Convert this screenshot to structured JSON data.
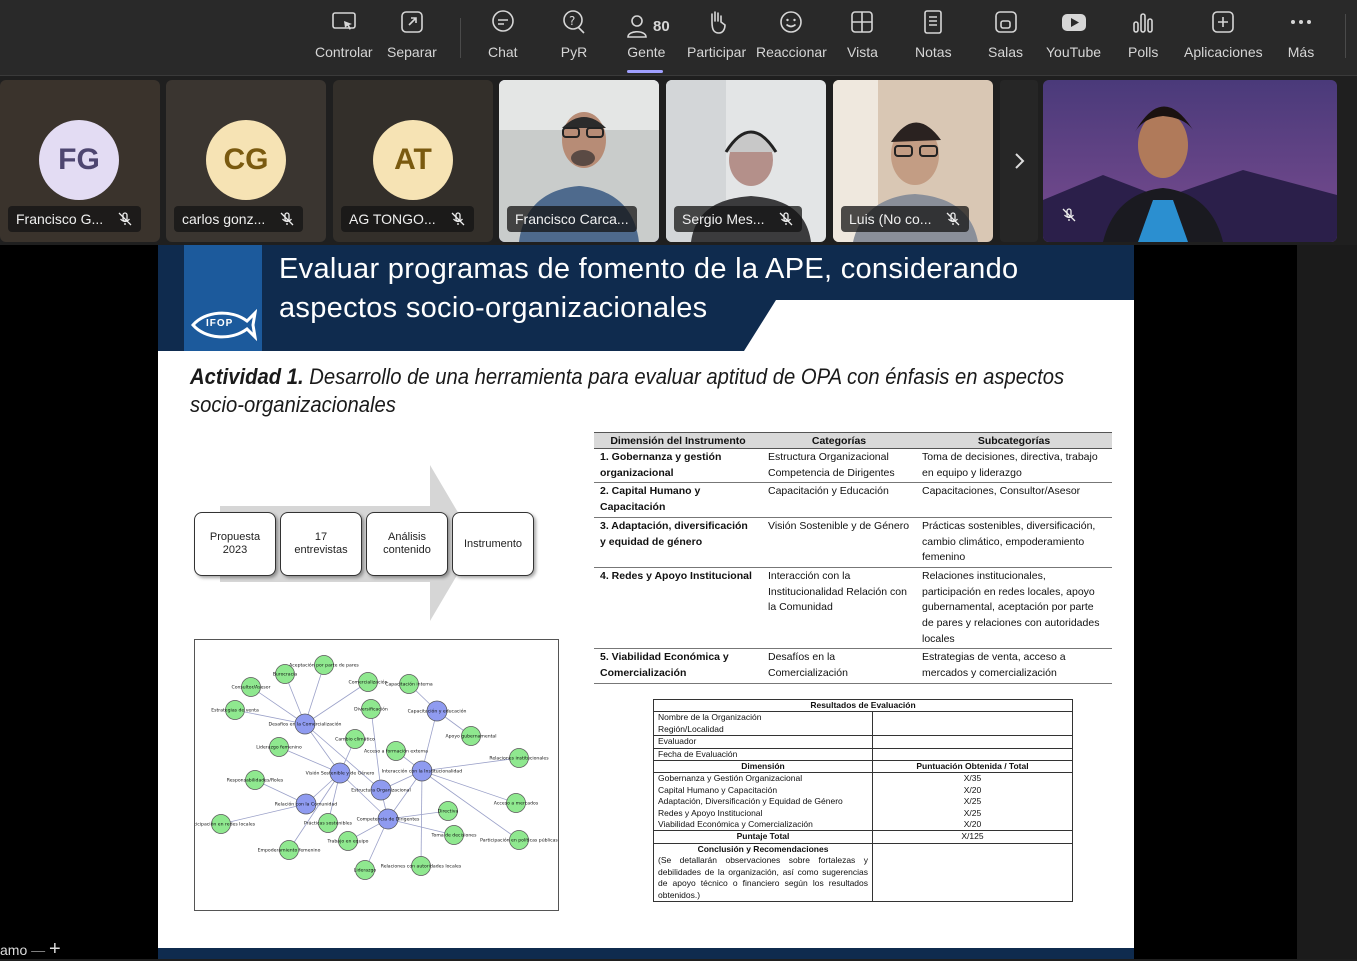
{
  "toolbar": {
    "buttons": [
      {
        "label": "Controlar",
        "icon": "share-control-icon"
      },
      {
        "label": "Separar",
        "icon": "pop-out-icon"
      },
      {
        "label": "Chat",
        "icon": "chat-icon"
      },
      {
        "label": "PyR",
        "icon": "qa-icon"
      },
      {
        "label": "Gente",
        "icon": "people-icon",
        "count": "80"
      },
      {
        "label": "Participar",
        "icon": "raise-hand-icon"
      },
      {
        "label": "Reaccionar",
        "icon": "smiley-icon"
      },
      {
        "label": "Vista",
        "icon": "grid-view-icon"
      },
      {
        "label": "Notas",
        "icon": "notes-icon"
      },
      {
        "label": "Salas",
        "icon": "rooms-icon"
      },
      {
        "label": "YouTube",
        "icon": "youtube-icon"
      },
      {
        "label": "Polls",
        "icon": "polls-icon"
      },
      {
        "label": "Aplicaciones",
        "icon": "apps-icon"
      },
      {
        "label": "Más",
        "icon": "more-icon"
      }
    ]
  },
  "participants": [
    {
      "initials": "FG",
      "name": "Francisco G..."
    },
    {
      "initials": "CG",
      "name": "carlos gonz..."
    },
    {
      "initials": "AT",
      "name": "AG TONGO..."
    },
    {
      "name": "Francisco Carca..."
    },
    {
      "name": "Sergio Mes..."
    },
    {
      "name": "Luis (No co..."
    }
  ],
  "colors": {
    "accent": "#a0a0ff",
    "slide_navy": "#0f2b4e",
    "slide_blue": "#1c5a9c"
  },
  "slide": {
    "logo_text": "IFOP",
    "title_line1": "Evaluar programas de fomento de la APE, considerando",
    "title_line2": "aspectos socio-organizacionales",
    "activity_bold": "Actividad 1.",
    "activity_text": " Desarrollo de una herramienta para evaluar aptitud de OPA con énfasis en aspectos socio-organizacionales",
    "process": [
      {
        "l1": "Propuesta",
        "l2": "2023"
      },
      {
        "l1": "17",
        "l2": "entrevistas"
      },
      {
        "l1": "Análisis",
        "l2": "contenido"
      },
      {
        "l1": "Instrumento",
        "l2": ""
      }
    ],
    "dim_table": {
      "headers": [
        "Dimensión del Instrumento",
        "Categorías",
        "Subcategorías"
      ],
      "rows": [
        {
          "dim": "1. Gobernanza y gestión organizacional",
          "cat": "Estructura Organizacional Competencia de Dirigentes",
          "sub": "Toma de decisiones, directiva, trabajo en equipo y liderazgo"
        },
        {
          "dim": "2. Capital Humano y Capacitación",
          "cat": "Capacitación y Educación",
          "sub": "Capacitaciones, Consultor/Asesor"
        },
        {
          "dim": "3. Adaptación, diversificación y equidad de género",
          "cat": "Visión Sostenible y de Género",
          "sub": "Prácticas sostenibles, diversificación, cambio climático, empoderamiento femenino"
        },
        {
          "dim": "4. Redes y Apoyo Institucional",
          "cat": "Interacción con la Institucionalidad Relación con la Comunidad",
          "sub": "Relaciones institucionales, participación en redes locales, apoyo gubernamental, aceptación por parte de pares y relaciones con autoridades locales"
        },
        {
          "dim": "5. Viabilidad Económica y Comercialización",
          "cat": "Desafíos en la Comercialización",
          "sub": "Estrategias de venta, acceso a mercados y comercialización"
        }
      ]
    },
    "eval": {
      "title": "Resultados de Evaluación",
      "fields": [
        "Nombre de la Organización",
        "Región/Localidad",
        "Evaluador",
        "Fecha de Evaluación"
      ],
      "col_dim": "Dimensión",
      "col_score": "Puntuación Obtenida / Total",
      "scores": [
        {
          "dim": "Gobernanza y Gestión Organizacional",
          "score": "X/35"
        },
        {
          "dim": "Capital Humano y Capacitación",
          "score": "X/20"
        },
        {
          "dim": "Adaptación, Diversificación y Equidad de Género",
          "score": "X/25"
        },
        {
          "dim": "Redes y Apoyo Institucional",
          "score": "X/25"
        },
        {
          "dim": "Viabilidad Económica y Comercialización",
          "score": "X/20"
        }
      ],
      "total_label": "Puntaje Total",
      "total_score": "X/125",
      "conclusion_title": "Conclusión y Recomendaciones",
      "conclusion_text": "(Se detallarán observaciones sobre fortalezas y debilidades de la organización, así como sugerencias de apoyo técnico o financiero según los resultados obtenidos.)"
    },
    "network": {
      "hubs": [
        "Desafíos en la Comercialización",
        "Visión Sostenible y de Género",
        "Competencia de Dirigentes",
        "Interacción con la Institucionalidad",
        "Relación con la Comunidad",
        "Capacitación y educación",
        "Estructura Organizacional"
      ],
      "leaves": [
        "Aceptación por parte de pares",
        "Burocracia",
        "Consultor/Asesor",
        "Comercialización",
        "Capacitación interna",
        "Estrategias de venta",
        "Diversificación",
        "Apoyo gubernamental",
        "Cambio climático",
        "Liderazgo femenino",
        "Acceso a formación externa",
        "Relaciones institucionales",
        "Responsabilidades/Roles",
        "Acceso a mercados",
        "Directiva",
        "Participación en redes locales",
        "Prácticas sostenibles",
        "Toma de decisiones",
        "Trabajo en equipo",
        "Participación en políticas públicas",
        "Empoderamiento femenino",
        "Liderazgo",
        "Relaciones con autoridades locales"
      ]
    }
  },
  "footer": {
    "left_text": "amo"
  }
}
